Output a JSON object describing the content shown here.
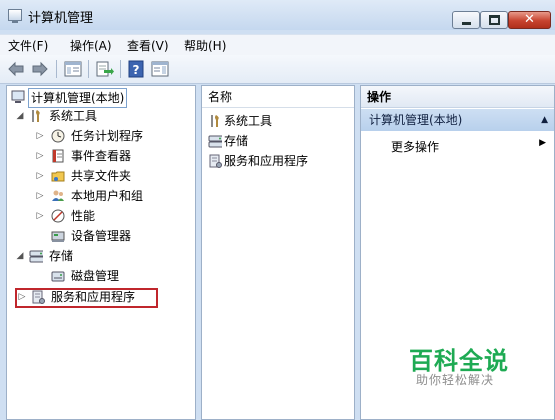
{
  "window": {
    "title": "计算机管理"
  },
  "menu": [
    "文件(F)",
    "操作(A)",
    "查看(V)",
    "帮助(H)"
  ],
  "toolbar": {
    "buttons": [
      "back-icon",
      "forward-icon",
      "show-hide-console-tree-icon",
      "export-list-icon",
      "help-icon",
      "show-hide-action-pane-icon"
    ]
  },
  "tree": {
    "root": "计算机管理(本地)",
    "system_tools": "系统工具",
    "task_scheduler": "任务计划程序",
    "event_viewer": "事件查看器",
    "shared_folders": "共享文件夹",
    "local_users": "本地用户和组",
    "performance": "性能",
    "device_manager": "设备管理器",
    "storage": "存储",
    "disk_management": "磁盘管理",
    "services_apps": "服务和应用程序"
  },
  "list": {
    "header": "名称",
    "items": [
      "系统工具",
      "存储",
      "服务和应用程序"
    ]
  },
  "actions": {
    "header": "操作",
    "group": "计算机管理(本地)",
    "more": "更多操作"
  },
  "watermark": {
    "main": "百科全说",
    "sub": "助你轻松解决"
  },
  "colors": {
    "highlight_box": "#c0262c",
    "watermark_green": "#1eaa53"
  }
}
